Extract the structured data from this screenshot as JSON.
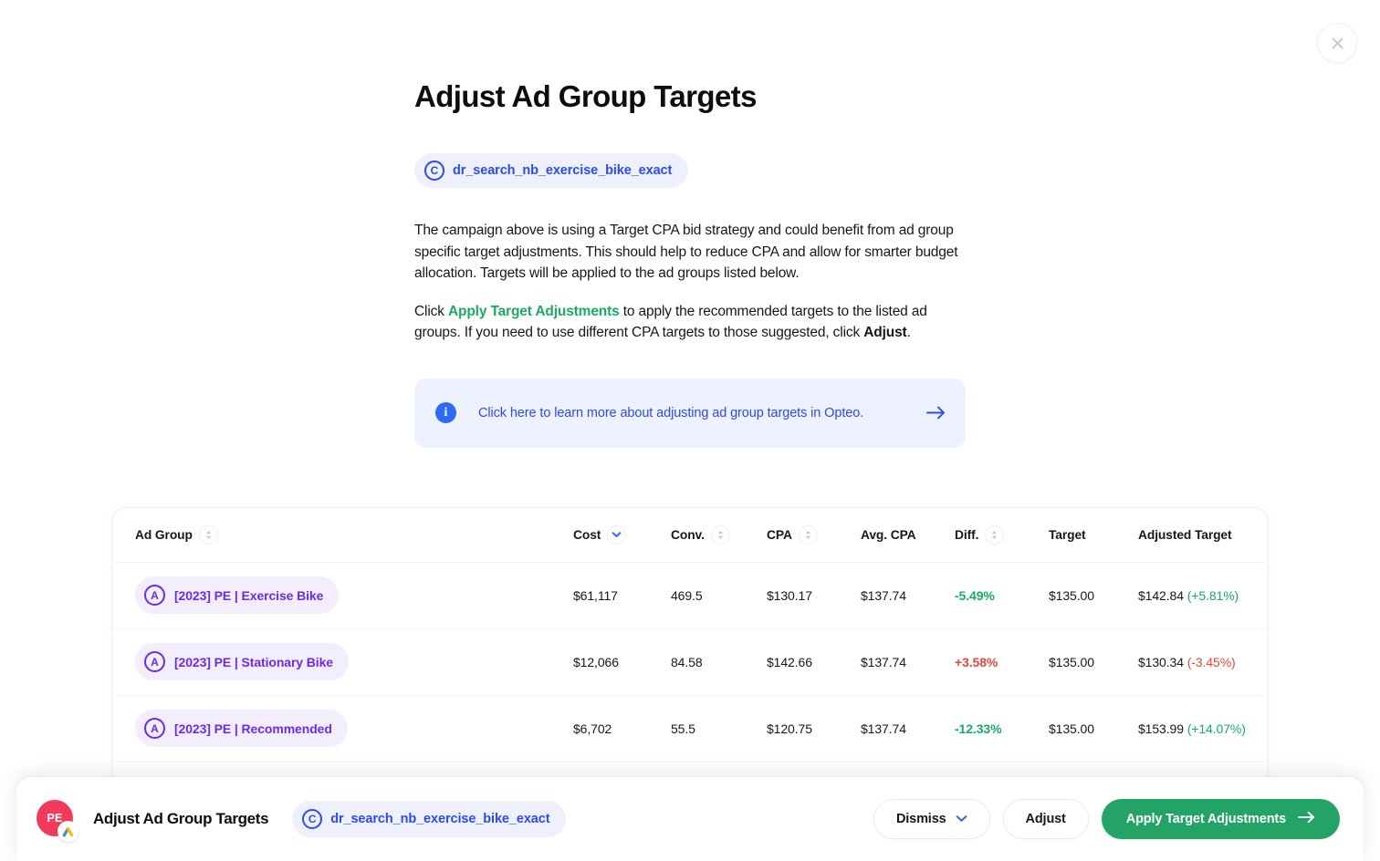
{
  "window": {
    "close_icon": "close-icon"
  },
  "header": {
    "title": "Adjust Ad Group Targets",
    "campaign_chip": {
      "icon_letter": "C",
      "label": "dr_search_nb_exercise_bike_exact"
    }
  },
  "body": {
    "paragraph_1": "The campaign above is using a Target CPA bid strategy and could benefit from ad group specific target adjustments. This should help to reduce CPA and allow for smarter budget allocation. Targets will be applied to the ad groups listed below.",
    "paragraph_2_part_1": "Click ",
    "paragraph_2_link": "Apply Target Adjustments",
    "paragraph_2_part_2": " to apply the recommended targets to the listed ad groups. If you need to use different CPA targets to those suggested, click ",
    "paragraph_2_bold": "Adjust",
    "paragraph_2_part_3": ".",
    "banner": {
      "icon": "info-icon",
      "text": "Click here to learn more about adjusting ad group targets in Opteo.",
      "arrow_icon": "arrow-right-icon"
    }
  },
  "table": {
    "columns": [
      {
        "key": "name",
        "label": "Ad Group",
        "sortable": true,
        "sorted": false
      },
      {
        "key": "cost",
        "label": "Cost",
        "sortable": true,
        "sorted": true
      },
      {
        "key": "conv",
        "label": "Conv.",
        "sortable": true,
        "sorted": false
      },
      {
        "key": "cpa",
        "label": "CPA",
        "sortable": true,
        "sorted": false
      },
      {
        "key": "avg",
        "label": "Avg. CPA",
        "sortable": false,
        "sorted": false
      },
      {
        "key": "diff",
        "label": "Diff.",
        "sortable": true,
        "sorted": false
      },
      {
        "key": "targ",
        "label": "Target",
        "sortable": false,
        "sorted": false
      },
      {
        "key": "adj",
        "label": "Adjusted Target",
        "sortable": false,
        "sorted": false
      }
    ],
    "sort_active_column": "Cost",
    "sort_direction": "desc",
    "rows": [
      {
        "icon_letter": "A",
        "name": "[2023] PE | Exercise Bike",
        "cost": "$61,117",
        "conv": "469.5",
        "cpa": "$130.17",
        "avg_cpa": "$137.74",
        "diff": "-5.49%",
        "diff_sign": "negative",
        "target": "$135.00",
        "adjusted_target": "$142.84",
        "adjusted_delta": "(+5.81%)",
        "adjusted_delta_sign": "up"
      },
      {
        "icon_letter": "A",
        "name": "[2023] PE | Stationary Bike",
        "cost": "$12,066",
        "conv": "84.58",
        "cpa": "$142.66",
        "avg_cpa": "$137.74",
        "diff": "+3.58%",
        "diff_sign": "positive",
        "target": "$135.00",
        "adjusted_target": "$130.34",
        "adjusted_delta": "(-3.45%)",
        "adjusted_delta_sign": "down"
      },
      {
        "icon_letter": "A",
        "name": "[2023] PE | Recommended",
        "cost": "$6,702",
        "conv": "55.5",
        "cpa": "$120.75",
        "avg_cpa": "$137.74",
        "diff": "-12.33%",
        "diff_sign": "negative",
        "target": "$135.00",
        "adjusted_target": "$153.99",
        "adjusted_delta": "(+14.07%)",
        "adjusted_delta_sign": "up"
      }
    ]
  },
  "bottom_bar": {
    "avatar_initials": "PE",
    "avatar_badge_icon": "google-ads-icon",
    "title": "Adjust Ad Group Targets",
    "campaign_chip": {
      "icon_letter": "C",
      "label": "dr_search_nb_exercise_bike_exact"
    },
    "dismiss_label": "Dismiss",
    "dismiss_icon": "chevron-down-icon",
    "adjust_label": "Adjust",
    "apply_label": "Apply Target Adjustments",
    "apply_icon": "arrow-right-icon"
  },
  "colors": {
    "brand_blue": "#2b4beb",
    "brand_purple": "#6d2ae8",
    "green": "#18ab63",
    "primary_green": "#23a366",
    "red": "#e8453c",
    "avatar_red": "#f23b5c"
  }
}
